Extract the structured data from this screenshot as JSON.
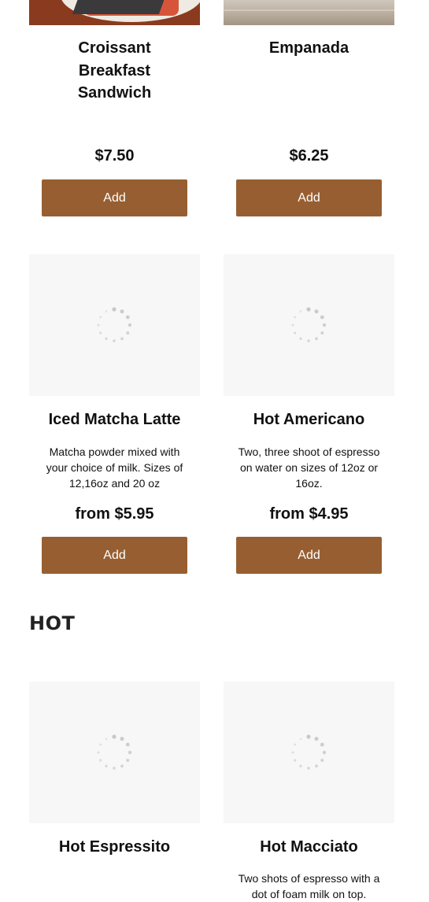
{
  "section": {
    "heading": "HOT"
  },
  "products": {
    "croissant": {
      "title": "Croissant Breakfast Sandwich",
      "price": "$7.50",
      "add_label": "Add"
    },
    "empanada": {
      "title": "Empanada",
      "price": "$6.25",
      "add_label": "Add"
    },
    "iced_matcha": {
      "title": "Iced Matcha Latte",
      "description": "Matcha powder mixed with your choice of milk. Sizes of 12,16oz and 20 oz",
      "price": "from $5.95",
      "add_label": "Add"
    },
    "hot_americano": {
      "title": "Hot Americano",
      "description": "Two, three shoot of espresso on water on sizes of 12oz or 16oz.",
      "price": "from $4.95",
      "add_label": "Add"
    },
    "hot_espressito": {
      "title": "Hot Espressito"
    },
    "hot_macciato": {
      "title": "Hot Macciato",
      "description": "Two shots of espresso with a dot of foam milk on top."
    }
  },
  "icons": {
    "loading": "loading-spinner-icon"
  },
  "colors": {
    "add_button": "#975f31",
    "image_placeholder": "#f7f7f7"
  }
}
